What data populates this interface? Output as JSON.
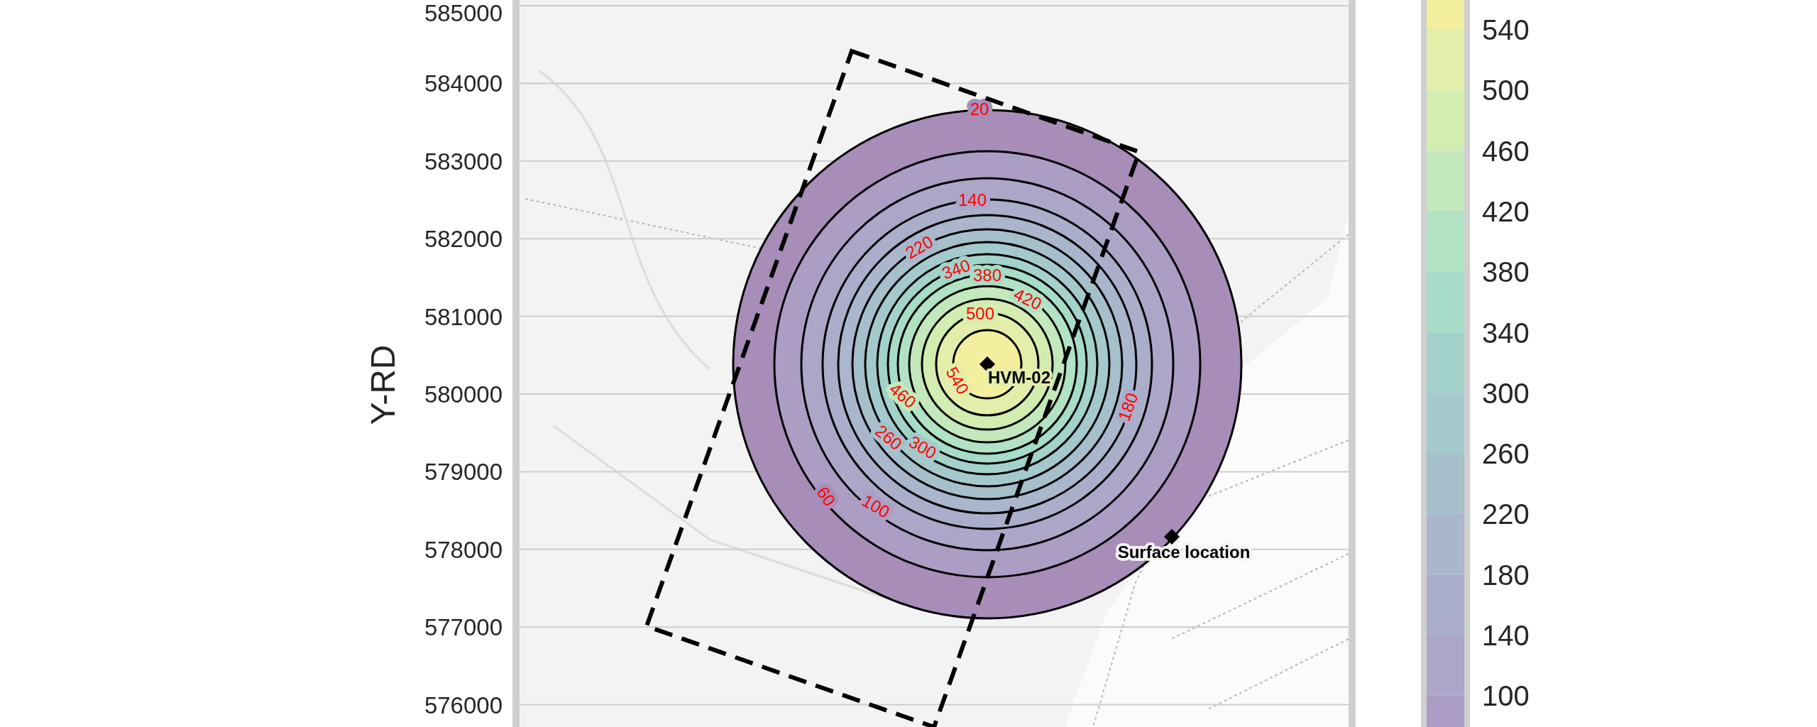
{
  "y_axis": {
    "label": "Y-RD",
    "ticks": [
      "585000",
      "584000",
      "583000",
      "582000",
      "581000",
      "580000",
      "579000",
      "578000",
      "577000",
      "576000"
    ]
  },
  "contours": [
    {
      "label": "20"
    },
    {
      "label": "60"
    },
    {
      "label": "100"
    },
    {
      "label": "140"
    },
    {
      "label": "180"
    },
    {
      "label": "220"
    },
    {
      "label": "260"
    },
    {
      "label": "300"
    },
    {
      "label": "340"
    },
    {
      "label": "380"
    },
    {
      "label": "420"
    },
    {
      "label": "460"
    },
    {
      "label": "500"
    },
    {
      "label": "540"
    }
  ],
  "markers": [
    {
      "kind": "well",
      "label": "HVM-02"
    },
    {
      "kind": "surface",
      "label": "Surface location"
    }
  ],
  "colorbar": {
    "ticks": [
      "540",
      "500",
      "460",
      "420",
      "380",
      "340",
      "300",
      "260",
      "220",
      "180",
      "140",
      "100"
    ]
  }
}
